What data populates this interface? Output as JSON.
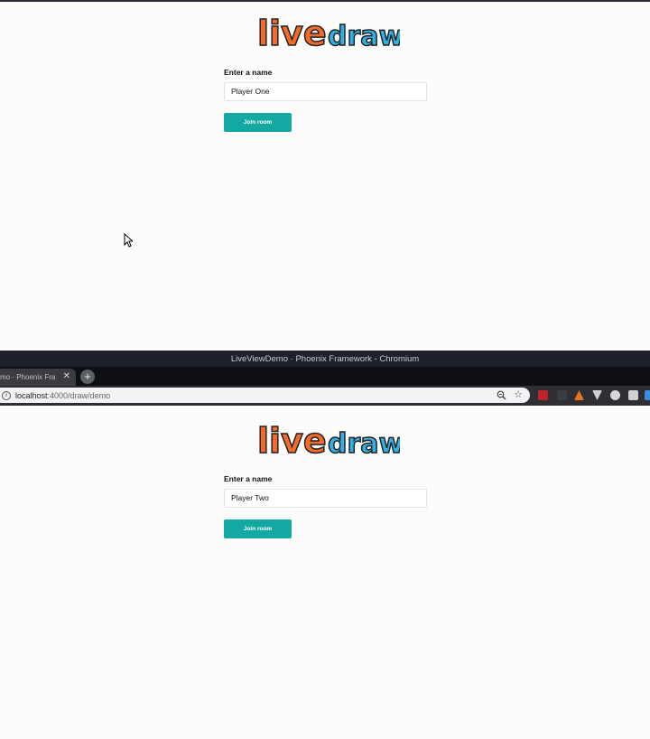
{
  "top_page": {
    "logo": {
      "word1": "live",
      "word2": "draw",
      "word1_color": "#f26a2c",
      "word2_color": "#33b0e6"
    },
    "form": {
      "label": "Enter a name",
      "input_value": "Player One",
      "button_label": "Join room"
    }
  },
  "browser": {
    "title": "LiveViewDemo · Phoenix Framework - Chromium",
    "tab_title": "mo · Phoenix Fra",
    "new_tab_symbol": "+",
    "close_symbol": "✕",
    "url_host": "localhost",
    "url_path": ":4000/draw/demo",
    "extensions": [
      {
        "icon": "ublock-icon",
        "color": "#c0242b"
      },
      {
        "icon": "extension-icon",
        "color": "#3a3c42"
      },
      {
        "icon": "fox-icon",
        "color": "#e8731e"
      },
      {
        "icon": "vue-devtools-icon",
        "color": "#cfd0d2"
      },
      {
        "icon": "spider-icon",
        "color": "#d6d6d6"
      },
      {
        "icon": "puzzle-icon",
        "color": "#cfd0d2"
      },
      {
        "icon": "profile-icon",
        "color": "#3b8de0"
      }
    ]
  },
  "bottom_page": {
    "logo": {
      "word1": "live",
      "word2": "draw"
    },
    "form": {
      "label": "Enter a name",
      "input_value": "Player Two",
      "button_label": "Join room"
    }
  },
  "colors": {
    "accent": "#14a8a3",
    "chrome_dark": "#1f2128"
  }
}
